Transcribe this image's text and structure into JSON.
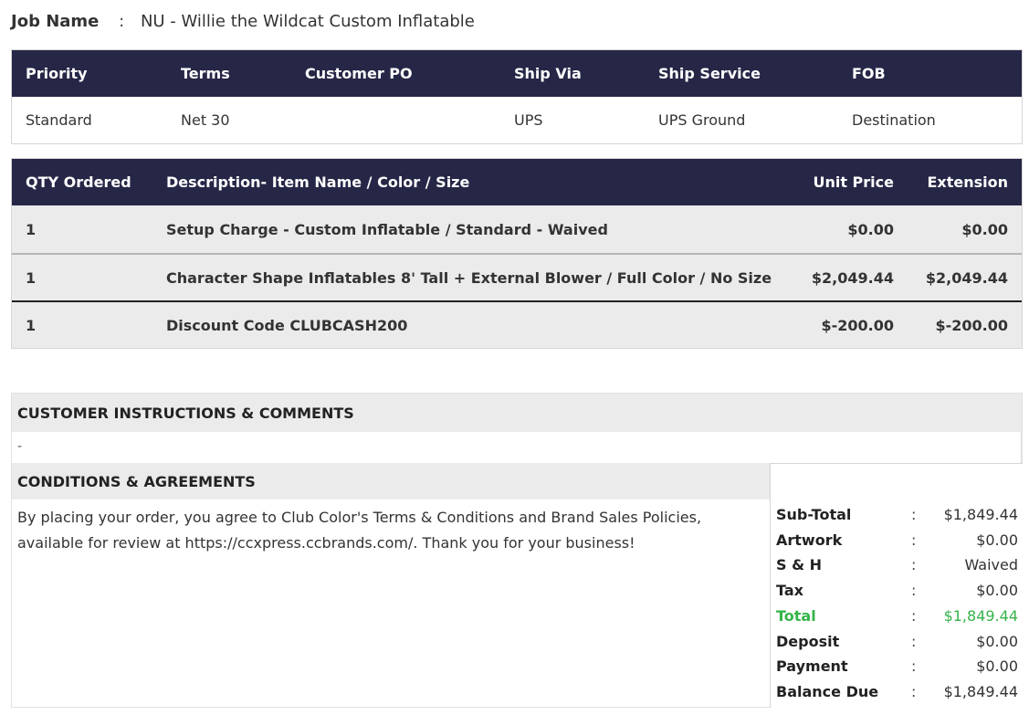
{
  "job": {
    "label": "Job Name",
    "sep": ":",
    "value": "NU - Willie the Wildcat Custom Inflatable"
  },
  "shipping": {
    "headers": {
      "priority": "Priority",
      "terms": "Terms",
      "po": "Customer PO",
      "via": "Ship Via",
      "service": "Ship Service",
      "fob": "FOB"
    },
    "values": {
      "priority": "Standard",
      "terms": "Net 30",
      "po": "",
      "via": "UPS",
      "service": "UPS Ground",
      "fob": "Destination"
    }
  },
  "items": {
    "headers": {
      "qty": "QTY Ordered",
      "desc": "Description- Item Name / Color / Size",
      "unit": "Unit Price",
      "ext": "Extension"
    },
    "rows": [
      {
        "qty": "1",
        "desc": "Setup Charge - Custom Inflatable / Standard - Waived",
        "unit": "$0.00",
        "ext": "$0.00"
      },
      {
        "qty": "1",
        "desc": "Character Shape Inflatables 8' Tall + External Blower / Full Color / No Size",
        "unit": "$2,049.44",
        "ext": "$2,049.44"
      },
      {
        "qty": "1",
        "desc": "Discount Code CLUBCASH200",
        "unit": "$-200.00",
        "ext": "$-200.00"
      }
    ]
  },
  "instructions": {
    "title": "CUSTOMER INSTRUCTIONS & COMMENTS",
    "body": "-"
  },
  "conditions": {
    "title": "CONDITIONS & AGREEMENTS",
    "body": "By placing your order, you agree to Club Color's Terms & Conditions and Brand Sales Policies, available for review at https://ccxpress.ccbrands.com/. Thank you for your business!"
  },
  "totals": [
    {
      "label": "Sub-Total",
      "sep": ":",
      "value": "$1,849.44"
    },
    {
      "label": "Artwork",
      "sep": ":",
      "value": "$0.00"
    },
    {
      "label": "S & H",
      "sep": ":",
      "value": "Waived"
    },
    {
      "label": "Tax",
      "sep": ":",
      "value": "$0.00"
    },
    {
      "label": "Total",
      "sep": ":",
      "value": "$1,849.44"
    },
    {
      "label": "Deposit",
      "sep": ":",
      "value": "$0.00"
    },
    {
      "label": "Payment",
      "sep": ":",
      "value": "$0.00"
    },
    {
      "label": "Balance Due",
      "sep": ":",
      "value": "$1,849.44"
    }
  ],
  "colors": {
    "header_bg": "#262747",
    "row_bg": "#ebebeb",
    "total_green": "#35b34a"
  }
}
